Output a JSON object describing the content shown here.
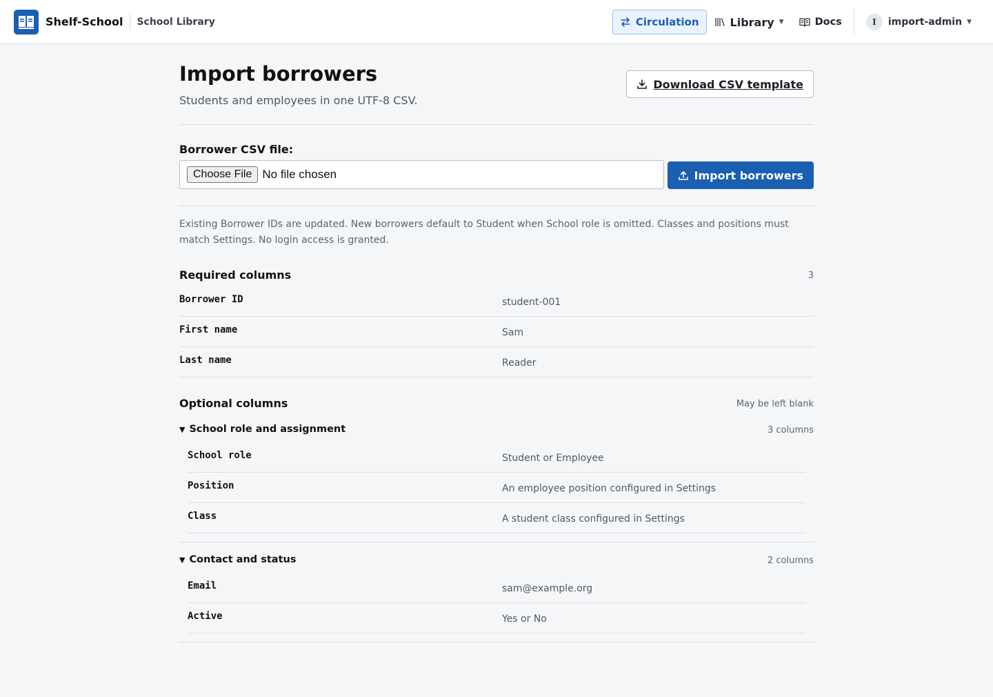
{
  "app": {
    "name": "Shelf-School",
    "subtitle": "School Library"
  },
  "nav": {
    "circulation": "Circulation",
    "library": "Library",
    "docs": "Docs",
    "user_initial": "I",
    "user": "import-admin"
  },
  "page": {
    "title": "Import borrowers",
    "subtitle": "Students and employees in one UTF-8 CSV.",
    "download_label": "Download CSV template"
  },
  "upload": {
    "label": "Borrower CSV file:",
    "choose_label": "Choose File",
    "file_status": "No file chosen",
    "import_label": "Import borrowers"
  },
  "note": "Existing Borrower IDs are updated. New borrowers default to Student when School role is omitted. Classes and positions must match Settings. No login access is granted.",
  "required": {
    "title": "Required columns",
    "count": "3",
    "rows": [
      {
        "key": "Borrower ID",
        "example": "student-001"
      },
      {
        "key": "First name",
        "example": "Sam"
      },
      {
        "key": "Last name",
        "example": "Reader"
      }
    ]
  },
  "optional": {
    "title": "Optional columns",
    "meta": "May be left blank",
    "groups": [
      {
        "title": "School role and assignment",
        "meta": "3 columns",
        "rows": [
          {
            "key": "School role",
            "example": "Student or Employee"
          },
          {
            "key": "Position",
            "example": "An employee position configured in Settings"
          },
          {
            "key": "Class",
            "example": "A student class configured in Settings"
          }
        ]
      },
      {
        "title": "Contact and status",
        "meta": "2 columns",
        "rows": [
          {
            "key": "Email",
            "example": "sam@example.org"
          },
          {
            "key": "Active",
            "example": "Yes or No"
          }
        ]
      }
    ]
  },
  "colors": {
    "accent": "#1b5fb0",
    "background": "#f5f6f8",
    "active_nav_bg": "#eaf3fd"
  },
  "icons": [
    "book-logo-icon",
    "swap-arrows-icon",
    "library-books-icon",
    "open-book-icon",
    "download-icon",
    "upload-icon",
    "caret-down-icon",
    "triangle-down-icon"
  ]
}
